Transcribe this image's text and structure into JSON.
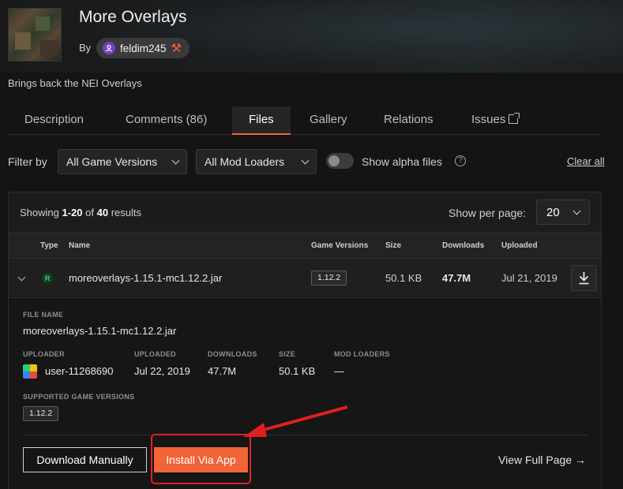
{
  "project": {
    "title": "More Overlays",
    "by_label": "By",
    "author": "feldim245",
    "summary": "Brings back the NEI Overlays"
  },
  "tabs": [
    {
      "label": "Description",
      "active": false
    },
    {
      "label": "Comments (86)",
      "active": false
    },
    {
      "label": "Files",
      "active": true
    },
    {
      "label": "Gallery",
      "active": false
    },
    {
      "label": "Relations",
      "active": false
    },
    {
      "label": "Issues",
      "active": false
    }
  ],
  "filters": {
    "label": "Filter by",
    "game_versions": "All Game Versions",
    "mod_loaders": "All Mod Loaders",
    "alpha_label": "Show alpha files",
    "help": "?",
    "clear_all": "Clear all"
  },
  "results": {
    "showing_prefix": "Showing",
    "range": "1-20",
    "of": "of",
    "total": "40",
    "suffix": "results",
    "per_page_label": "Show per page:",
    "per_page_value": "20"
  },
  "table": {
    "headers": [
      "Type",
      "Name",
      "Game Versions",
      "Size",
      "Downloads",
      "Uploaded"
    ],
    "rows": [
      {
        "type": "R",
        "name": "moreoverlays-1.15.1-mc1.12.2.jar",
        "game_version": "1.12.2",
        "size": "50.1 KB",
        "downloads": "47.7M",
        "uploaded": "Jul 21, 2019"
      }
    ]
  },
  "details": {
    "file_name_label": "FILE NAME",
    "file_name": "moreoverlays-1.15.1-mc1.12.2.jar",
    "uploader_label": "UPLOADER",
    "uploader": "user-11268690",
    "uploaded_label": "UPLOADED",
    "uploaded": "Jul 22, 2019",
    "downloads_label": "DOWNLOADS",
    "downloads": "47.7M",
    "size_label": "SIZE",
    "size": "50.1 KB",
    "mod_loaders_label": "MOD LOADERS",
    "mod_loaders": "—",
    "supported_label": "SUPPORTED GAME VERSIONS",
    "supported_version": "1.12.2",
    "download_manually": "Download Manually",
    "install_via_app": "Install Via App",
    "view_full_page": "View Full Page →"
  },
  "colors": {
    "accent": "#f16436",
    "annotation": "#e02020",
    "background": "#141414"
  }
}
